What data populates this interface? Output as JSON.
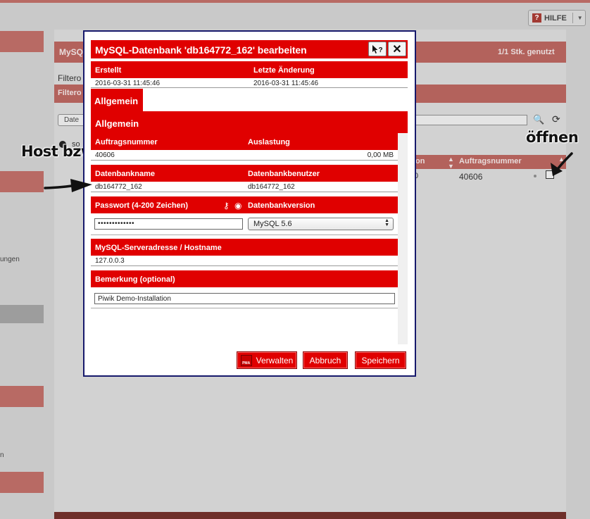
{
  "background": {
    "help_label": "HILFE",
    "help_icon": "?",
    "band_title": "MySQ",
    "band_right": "1/1 Stk. genutzt",
    "filter_label": "Filtero",
    "filter_label_2": "Filtero",
    "filter_input": "Date",
    "radio_label": "so",
    "left_text_1": "ungen",
    "left_text_2": "n",
    "table_col_1": "on",
    "table_col_2": "Auftragsnummer",
    "cell_value_1": "0",
    "cell_value_2": "40606"
  },
  "annotations": {
    "host_user": "Host bzw. Nutzer",
    "open": "öffnen"
  },
  "dialog": {
    "title": "MySQL-Datenbank 'db164772_162' bearbeiten",
    "help_button": "?",
    "close_button": "✕",
    "meta": {
      "created_label": "Erstellt",
      "modified_label": "Letzte Änderung",
      "created_value": "2016-03-31 11:45:46",
      "modified_value": "2016-03-31 11:45:46"
    },
    "tab_general": "Allgemein",
    "section_general": "Allgemein",
    "fields": {
      "order_number_label": "Auftragsnummer",
      "order_number_value": "40606",
      "usage_label": "Auslastung",
      "usage_value": "0,00 MB",
      "db_name_label": "Datenbankname",
      "db_name_value": "db164772_162",
      "db_user_label": "Datenbankbenutzer",
      "db_user_value": "db164772_162",
      "password_label": "Passwort (4-200 Zeichen)",
      "password_value": "•••••••••••••",
      "db_version_label": "Datenbankversion",
      "db_version_value": "MySQL 5.6",
      "host_label": "MySQL-Serveradresse / Hostname",
      "host_value": "127.0.0.3",
      "remark_label": "Bemerkung (optional)",
      "remark_value": "Piwik Demo-Installation"
    },
    "buttons": {
      "manage": "Verwalten",
      "manage_icon_text": "PMA",
      "cancel": "Abbruch",
      "save": "Speichern"
    }
  },
  "colors": {
    "dialog_red": "#e00000",
    "dialog_border": "#16196b",
    "dimmed_red": "#b3625c"
  },
  "icons": [
    "help-icon",
    "dropdown-arrow-icon",
    "search-icon",
    "refresh-icon",
    "open-record-icon",
    "cursor-help-icon",
    "close-icon",
    "key-icon",
    "eye-icon",
    "select-arrows-icon",
    "phpmyadmin-icon",
    "annotation-arrow-icon"
  ]
}
